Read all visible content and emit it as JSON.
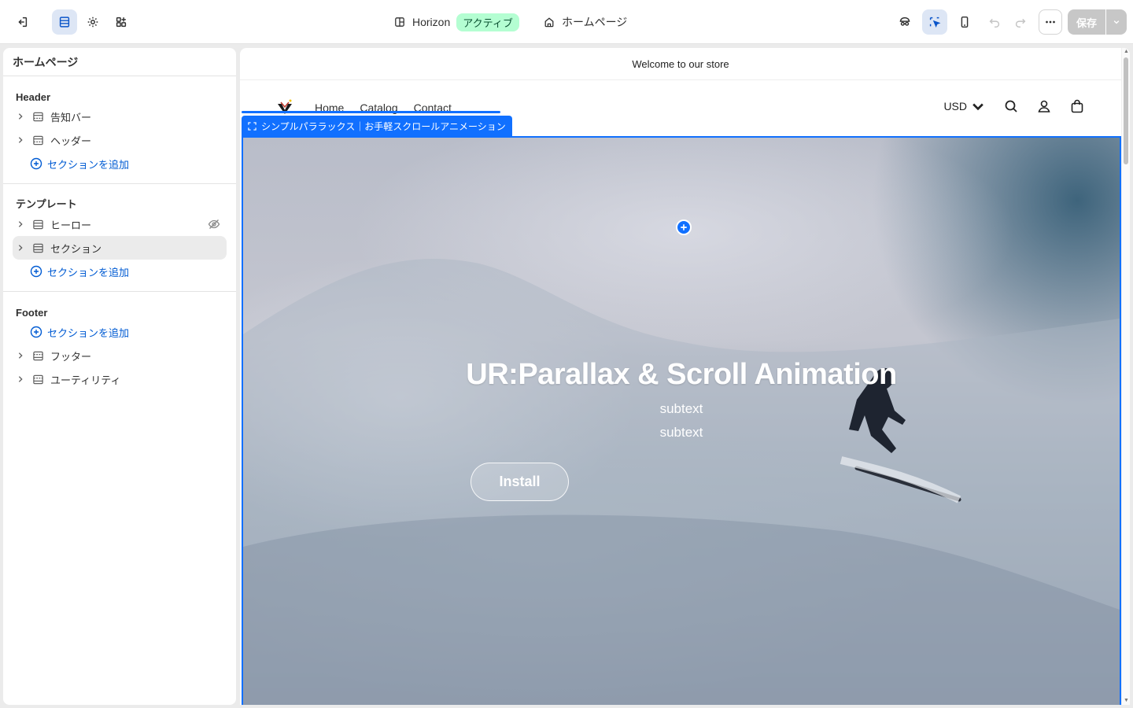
{
  "topbar": {
    "theme_name": "Horizon",
    "theme_status": "アクティブ",
    "page_name": "ホームページ",
    "save_label": "保存"
  },
  "sidebar": {
    "title": "ホームページ",
    "groups": [
      {
        "title": "Header",
        "items": [
          {
            "label": "告知バー"
          },
          {
            "label": "ヘッダー"
          }
        ],
        "add_label": "セクションを追加"
      },
      {
        "title": "テンプレート",
        "items": [
          {
            "label": "ヒーロー"
          },
          {
            "label": "セクション"
          }
        ],
        "add_label": "セクションを追加"
      },
      {
        "title": "Footer",
        "add_label": "セクションを追加",
        "items": [
          {
            "label": "フッター"
          },
          {
            "label": "ユーティリティ"
          }
        ]
      }
    ]
  },
  "preview": {
    "announcement": "Welcome to our store",
    "nav": [
      "Home",
      "Catalog",
      "Contact"
    ],
    "currency": "USD",
    "selection_tag": "シンプルパララックス｜お手軽スクロールアニメーション",
    "hero": {
      "title": "UR:Parallax & Scroll Animation",
      "subtext1": "subtext",
      "subtext2": "subtext",
      "button": "Install"
    }
  },
  "colors": {
    "accent": "#1170ff",
    "link": "#005bd3",
    "badge_bg": "#b4fed2"
  }
}
